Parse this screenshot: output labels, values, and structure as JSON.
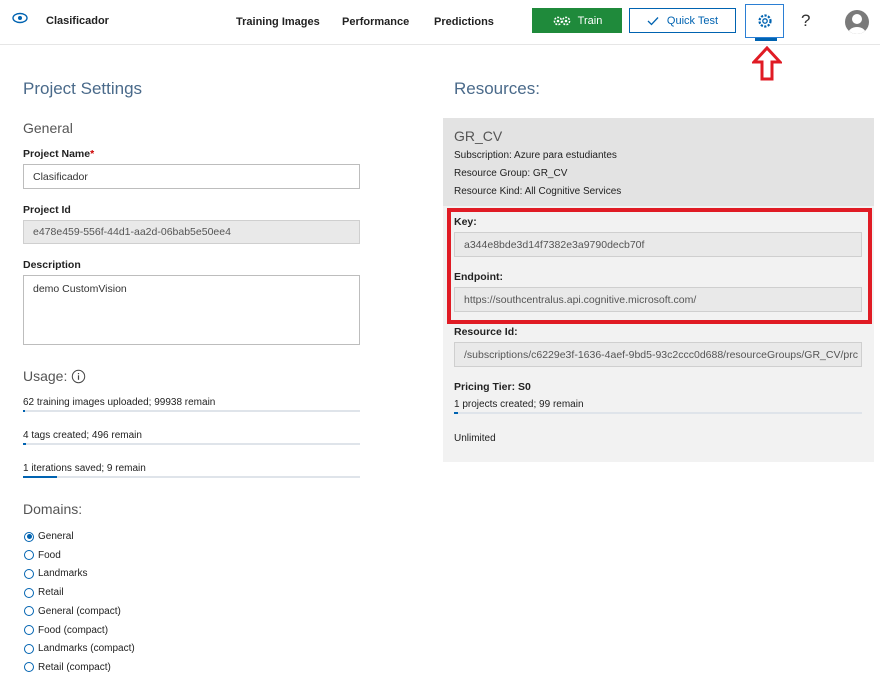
{
  "header": {
    "app_name": "Clasificador",
    "nav": [
      "Training Images",
      "Performance",
      "Predictions"
    ],
    "train_label": "Train",
    "quick_test_label": "Quick Test",
    "help_label": "?"
  },
  "left": {
    "title": "Project Settings",
    "general_heading": "General",
    "project_name_label": "Project Name",
    "project_name_required": "*",
    "project_name_value": "Clasificador",
    "project_id_label": "Project Id",
    "project_id_value": "e478e459-556f-44d1-aa2d-06bab5e50ee4",
    "description_label": "Description",
    "description_value": "demo CustomVision",
    "usage_heading": "Usage:",
    "usage": [
      {
        "text": "62 training images uploaded; 99938 remain",
        "fraction": 0.0006
      },
      {
        "text": "4 tags created; 496 remain",
        "fraction": 0.008
      },
      {
        "text": "1 iterations saved; 9 remain",
        "fraction": 0.1
      }
    ],
    "domains_heading": "Domains:",
    "domains": [
      {
        "label": "General",
        "selected": true
      },
      {
        "label": "Food",
        "selected": false
      },
      {
        "label": "Landmarks",
        "selected": false
      },
      {
        "label": "Retail",
        "selected": false
      },
      {
        "label": "General (compact)",
        "selected": false
      },
      {
        "label": "Food (compact)",
        "selected": false
      },
      {
        "label": "Landmarks (compact)",
        "selected": false
      },
      {
        "label": "Retail (compact)",
        "selected": false
      }
    ]
  },
  "resources": {
    "title": "Resources:",
    "name": "GR_CV",
    "subscription": "Subscription:  Azure para estudiantes",
    "resource_group": "Resource Group:  GR_CV",
    "resource_kind": "Resource Kind:  All Cognitive Services",
    "key_label": "Key:",
    "key_value": "a344e8bde3d14f7382e3a9790decb70f",
    "endpoint_label": "Endpoint:",
    "endpoint_value": "https://southcentralus.api.cognitive.microsoft.com/",
    "resource_id_label": "Resource Id:",
    "resource_id_value": "/subscriptions/c6229e3f-1636-4aef-9bd5-93c2ccc0d688/resourceGroups/GR_CV/prc",
    "pricing_tier_label": "Pricing Tier:",
    "pricing_tier_value": "S0",
    "projects_text": "1 projects created; 99 remain",
    "projects_fraction": 0.01,
    "unlimited_text": "Unlimited"
  },
  "colors": {
    "accent": "#0063b1",
    "train": "#1f8a3b",
    "highlight": "#e01b24"
  }
}
